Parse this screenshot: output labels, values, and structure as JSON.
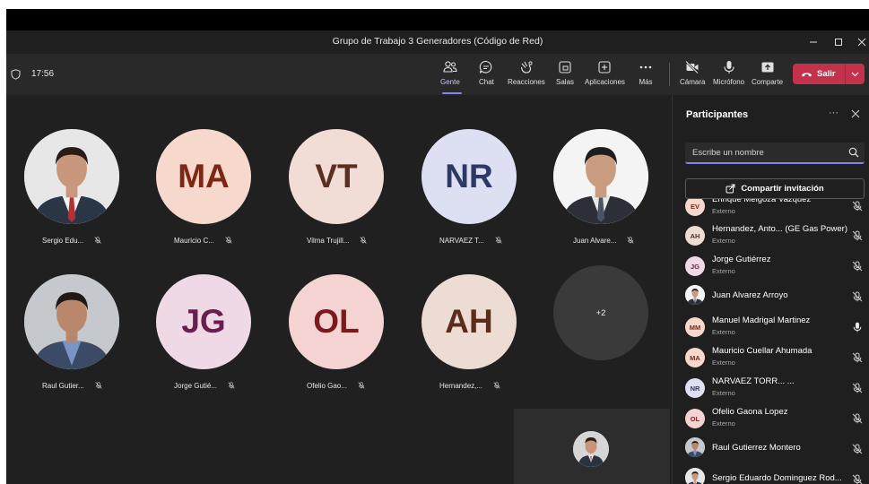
{
  "window": {
    "title": "Grupo de Trabajo 3 Generadores (Código de Red)"
  },
  "toolbar": {
    "time": "17:56",
    "buttons": [
      {
        "label": "Gente",
        "icon": "people-icon",
        "active": true
      },
      {
        "label": "Chat",
        "icon": "chat-icon",
        "active": false
      },
      {
        "label": "Reacciones",
        "icon": "reactions-icon",
        "active": false
      },
      {
        "label": "Salas",
        "icon": "rooms-icon",
        "active": false
      },
      {
        "label": "Aplicaciones",
        "icon": "apps-icon",
        "active": false
      },
      {
        "label": "Más",
        "icon": "more-icon",
        "active": false
      },
      {
        "label": "Cámara",
        "icon": "camera-off-icon",
        "active": false
      },
      {
        "label": "Micrófono",
        "icon": "microphone-icon",
        "active": false
      },
      {
        "label": "Comparte",
        "icon": "share-icon",
        "active": false
      }
    ],
    "leave_label": "Salir",
    "leave_color": "#c4314b",
    "accent_color": "#7f85f5"
  },
  "stage": {
    "tiles": [
      {
        "name": "Sergio Edu...",
        "initials": "",
        "photo": true,
        "bg": "#e9e9e9",
        "fg": "#333333"
      },
      {
        "name": "Mauricio C...",
        "initials": "MA",
        "photo": false,
        "bg": "#f6d8cc",
        "fg": "#7a2714"
      },
      {
        "name": "Vilma Trujill...",
        "initials": "VT",
        "photo": false,
        "bg": "#f1ddd6",
        "fg": "#5a2e20"
      },
      {
        "name": "NARVAEZ T...",
        "initials": "NR",
        "photo": false,
        "bg": "#dde0f2",
        "fg": "#2d3866"
      },
      {
        "name": "Juan Alvare...",
        "initials": "",
        "photo": true,
        "bg": "#e8e8e8",
        "fg": "#333333"
      },
      {
        "name": "Raul Gutier...",
        "initials": "",
        "photo": true,
        "bg": "#c9cdd2",
        "fg": "#333333"
      },
      {
        "name": "Jorge Gutié...",
        "initials": "JG",
        "photo": false,
        "bg": "#efd9e6",
        "fg": "#6a1d4e"
      },
      {
        "name": "Ofelio Gao...",
        "initials": "OL",
        "photo": false,
        "bg": "#f6d3d3",
        "fg": "#7a1a1a"
      },
      {
        "name": "Hernandez,...",
        "initials": "AH",
        "photo": false,
        "bg": "#ecdcd3",
        "fg": "#5a2c1c"
      }
    ],
    "more_count": "+2"
  },
  "panel": {
    "title": "Participantes",
    "search_placeholder": "Escribe un nombre",
    "invite_label": "Compartir invitación",
    "participants": [
      {
        "name": "Enrique Melgoza Vazquez",
        "sub": "Externo",
        "initials": "EV",
        "photo": false,
        "bg": "#f6d8cc",
        "fg": "#7a2714",
        "mic": "muted"
      },
      {
        "name": "Hernandez, Anto... (GE Gas Power)",
        "sub": "Externo",
        "initials": "AH",
        "photo": false,
        "bg": "#ecdcd3",
        "fg": "#5a2c1c",
        "mic": "muted"
      },
      {
        "name": "Jorge Gutiérrez",
        "sub": "Externo",
        "initials": "JG",
        "photo": false,
        "bg": "#efd9e6",
        "fg": "#6a1d4e",
        "mic": "muted"
      },
      {
        "name": "Juan Alvarez Arroyo",
        "sub": "",
        "initials": "",
        "photo": true,
        "bg": "#e8e8e8",
        "fg": "#333333",
        "mic": "muted"
      },
      {
        "name": "Manuel Madrigal Martinez",
        "sub": "Externo",
        "initials": "MM",
        "photo": false,
        "bg": "#f6d8cc",
        "fg": "#7a2714",
        "mic": "on"
      },
      {
        "name": "Mauricio Cuellar Ahumada",
        "sub": "Externo",
        "initials": "MA",
        "photo": false,
        "bg": "#f6d8cc",
        "fg": "#7a2714",
        "mic": "muted"
      },
      {
        "name": "NARVAEZ TORR... ...",
        "sub": "Externo",
        "initials": "NR",
        "photo": false,
        "bg": "#dde0f2",
        "fg": "#2d3866",
        "mic": "muted"
      },
      {
        "name": "Ofelio Gaona Lopez",
        "sub": "Externo",
        "initials": "OL",
        "photo": false,
        "bg": "#f6d3d3",
        "fg": "#7a1a1a",
        "mic": "muted"
      },
      {
        "name": "Raul Gutierrez Montero",
        "sub": "",
        "initials": "",
        "photo": true,
        "bg": "#c9cdd2",
        "fg": "#333333",
        "mic": "muted"
      },
      {
        "name": "Sergio Eduardo Dominguez Rod...",
        "sub": "",
        "initials": "",
        "photo": true,
        "bg": "#e9e9e9",
        "fg": "#333333",
        "mic": "muted"
      }
    ]
  }
}
